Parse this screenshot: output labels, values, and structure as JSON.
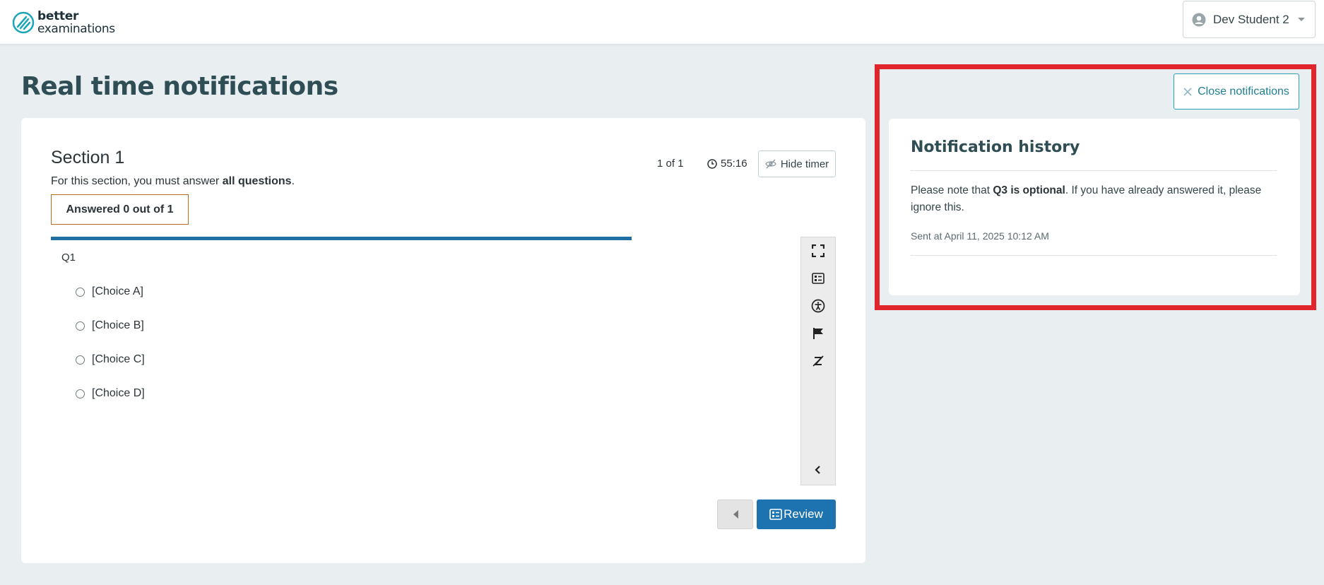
{
  "header": {
    "logo_line1": "better",
    "logo_line2": "examinations",
    "user_name": "Dev Student 2"
  },
  "page": {
    "title": "Real time notifications"
  },
  "section": {
    "title": "Section 1",
    "desc_prefix": "For this section, you must answer ",
    "desc_bold": "all questions",
    "desc_suffix": ".",
    "answered": "Answered 0 out of 1",
    "page_count": "1 of 1",
    "timer": "55:16",
    "hide_timer_label": "Hide timer"
  },
  "question": {
    "label": "Q1",
    "choices": [
      "[Choice A]",
      "[Choice B]",
      "[Choice C]",
      "[Choice D]"
    ]
  },
  "toolbar": {
    "icons": [
      "fullscreen-icon",
      "question-list-icon",
      "accessibility-icon",
      "flag-icon",
      "strikethrough-icon",
      "collapse-icon"
    ]
  },
  "nav": {
    "review_label": "Review"
  },
  "notifications": {
    "close_label": "Close notifications",
    "title": "Notification history",
    "msg_prefix": "Please note that ",
    "msg_bold": "Q3 is optional",
    "msg_suffix": ". If you have already answered it, please ignore this.",
    "sent_at": "Sent at April 11, 2025 10:12 AM"
  },
  "colors": {
    "accent_blue": "#1d72b0",
    "teal": "#1f7f93",
    "highlight_red": "#e0262c",
    "answered_border": "#b86a21"
  }
}
